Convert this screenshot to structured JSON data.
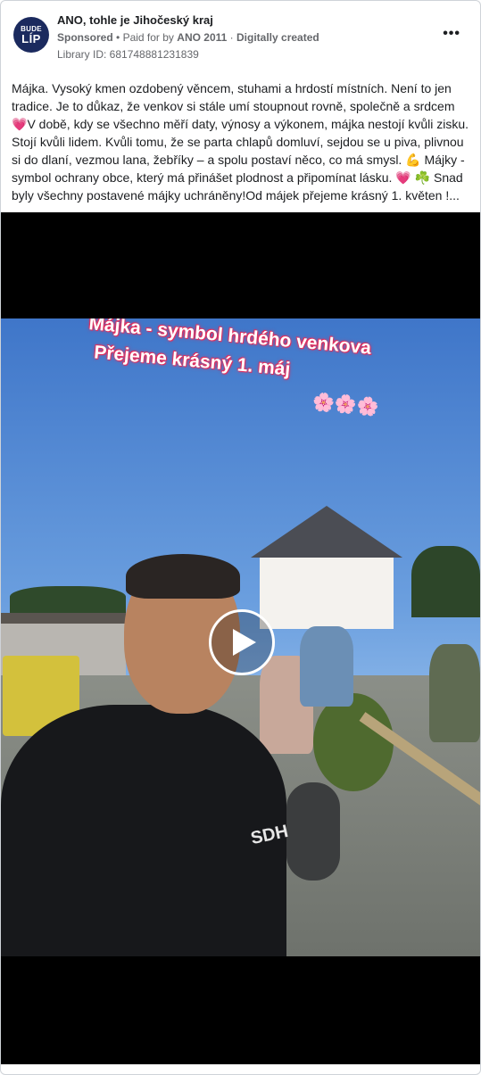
{
  "post": {
    "page_name": "ANO, tohle je Jihočeský kraj",
    "avatar_line1": "BUDE",
    "avatar_line2": "LÍP",
    "sponsored": "Sponsored",
    "separator": "•",
    "paid_for_prefix": "Paid for by",
    "paid_for_by": "ANO 2011",
    "separator2": "·",
    "digitally_created": "Digitally created",
    "library_id": "Library ID: 681748881231839",
    "more_options": "•••",
    "text_part1": "Májka. Vysoký kmen ozdobený věncem, stuhami a hrdostí místních. Není to jen tradice. Je to důkaz, že venkov si stále umí stoupnout rovně, společně a srdcem ",
    "heart1": "💗",
    "text_part2": "V době, kdy se všechno měří daty, výnosy a výkonem, májka nestojí kvůli zisku. Stojí kvůli lidem. Kvůli tomu, že se parta chlapů domluví, sejdou se u piva, plivnou si do dlaní, vezmou lana, žebříky – a spolu postaví něco, co má smysl. ",
    "muscle": "💪",
    "text_part3": " Májky - symbol ochrany obce, který má přinášet plodnost a připomínat lásku. ",
    "heart2": "💗",
    "shamrock": "☘️",
    "text_part4": " Snad byly všechny postavené májky uchráněny!Od májek přejeme krásný 1. květen !..."
  },
  "video": {
    "overlay_line1": "Májka - symbol hrdého venkova",
    "overlay_line2": "Přejeme krásný 1. máj",
    "overlay_flowers": "🌸🌸🌸",
    "shirt_text": "SDH",
    "play_icon": "play-icon"
  }
}
